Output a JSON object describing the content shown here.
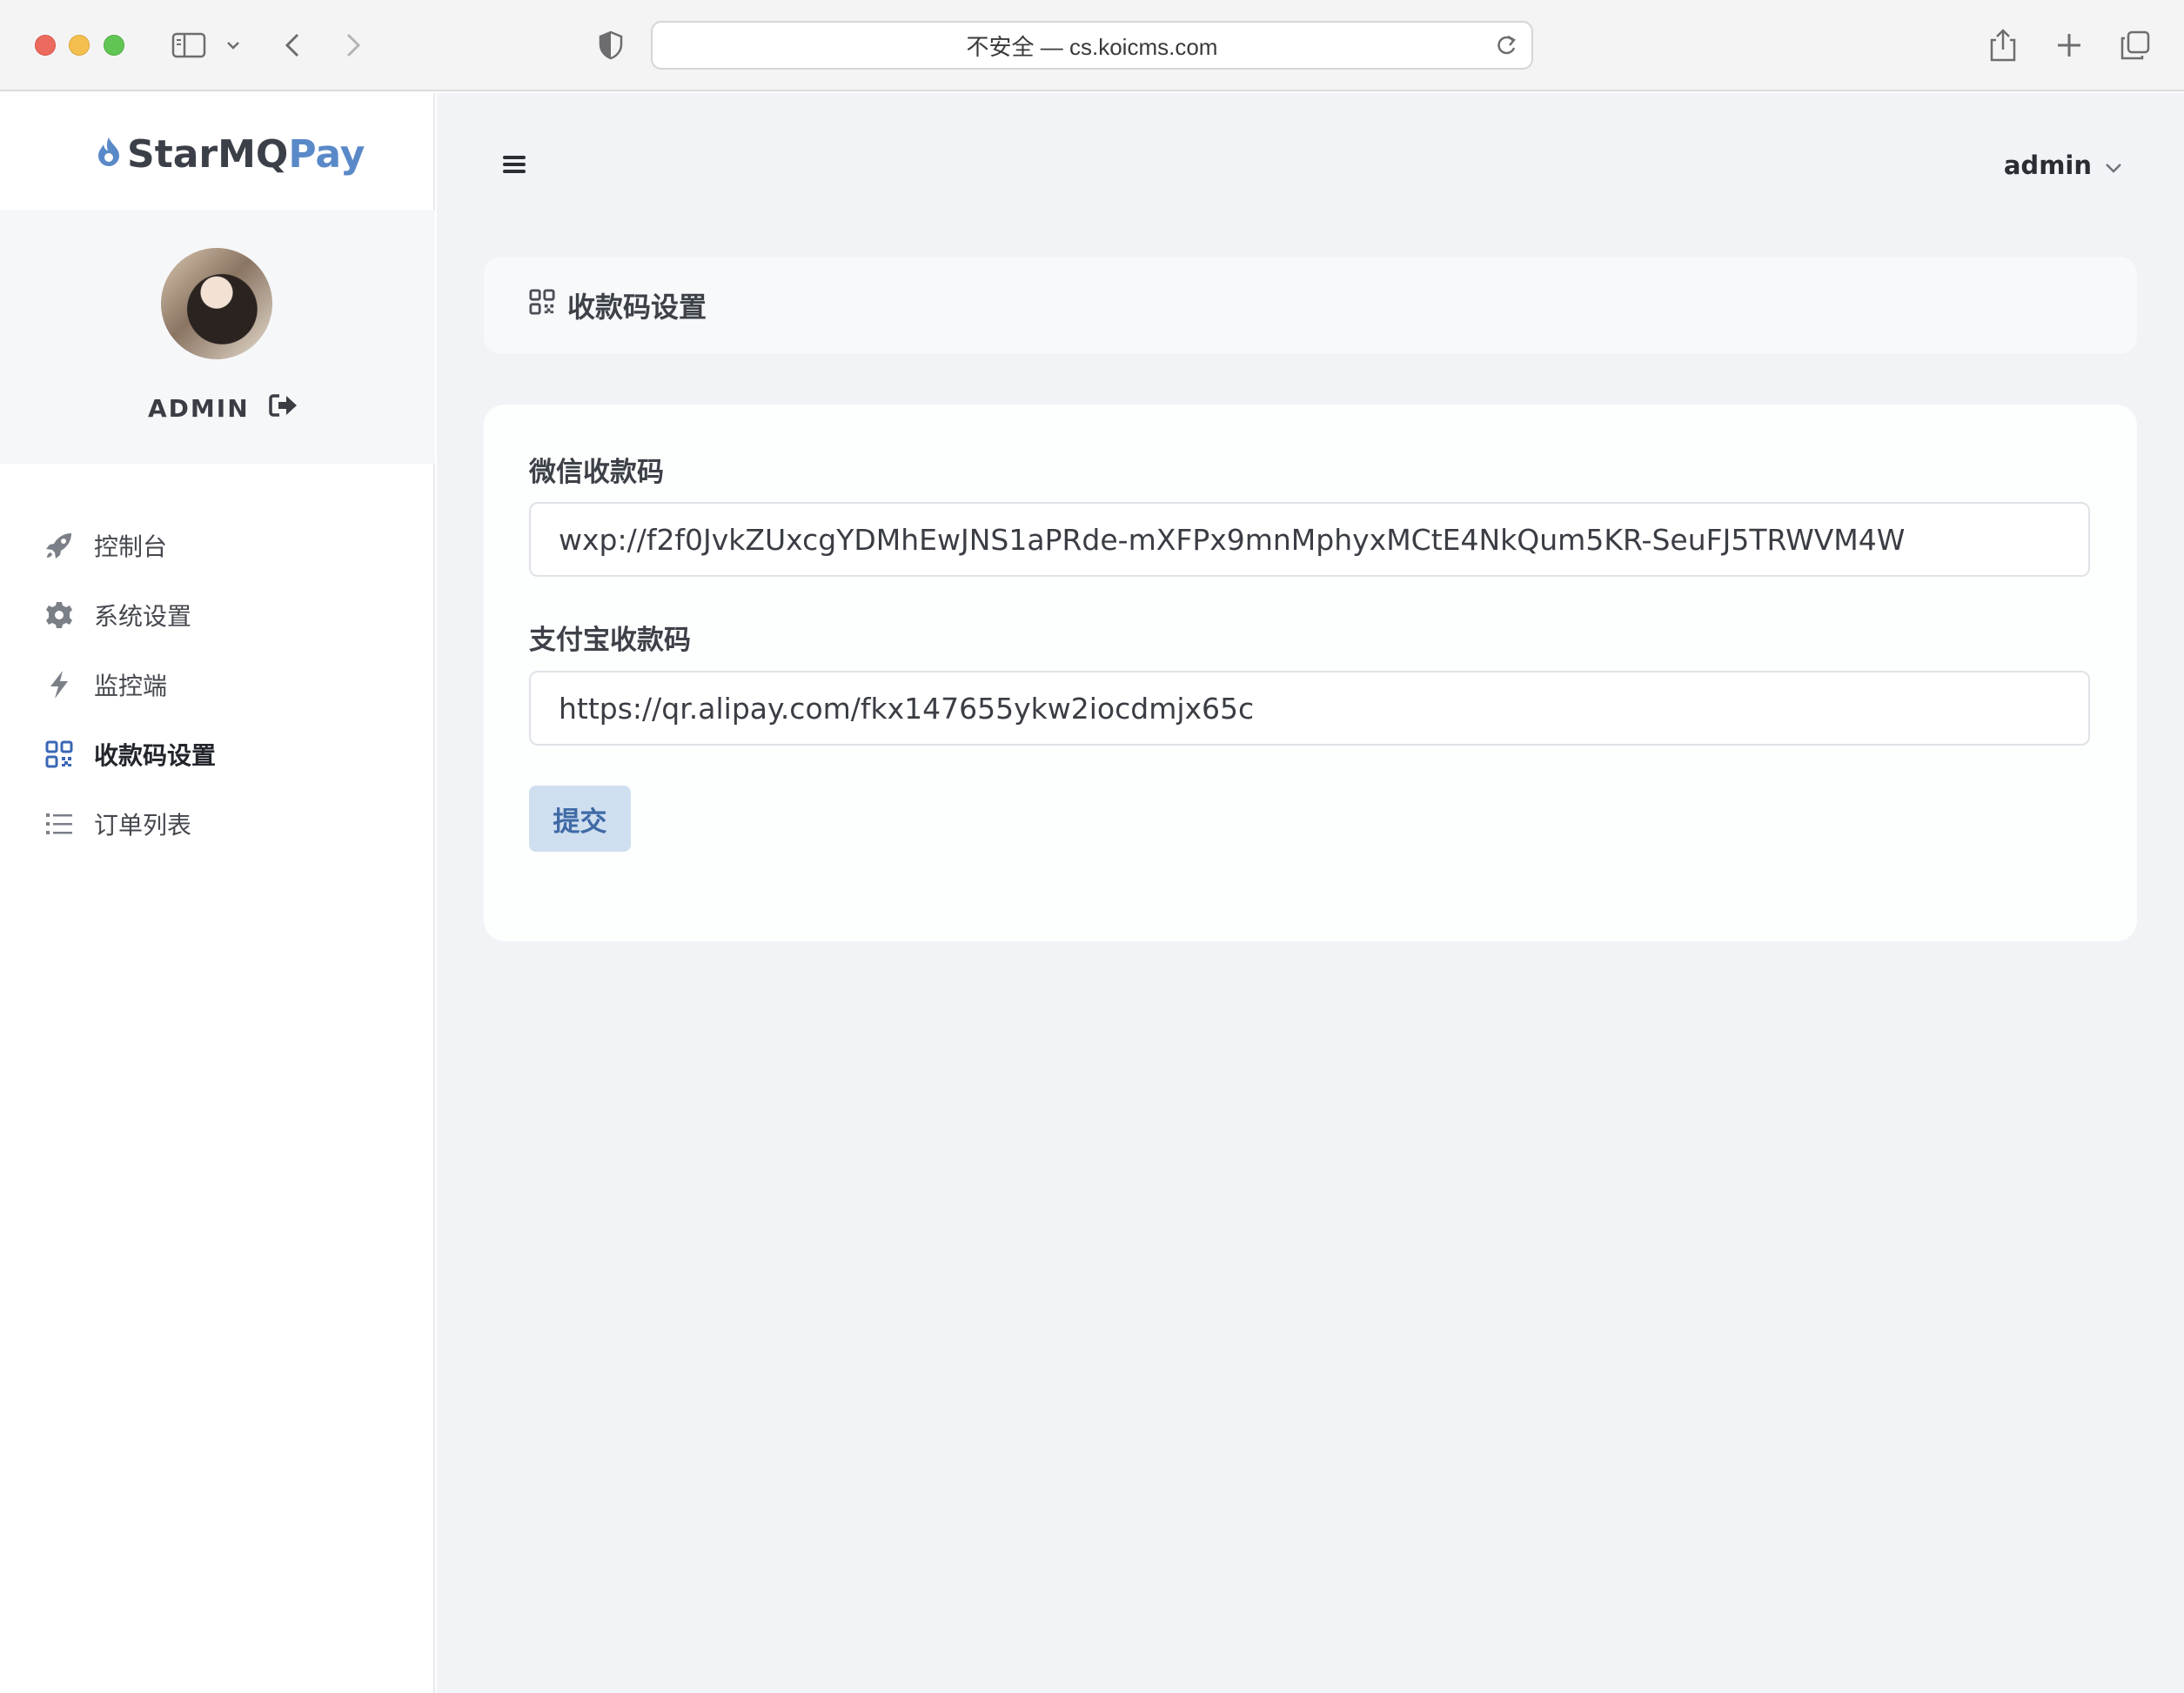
{
  "browser": {
    "url_text": "不安全 — cs.koicms.com"
  },
  "brand": {
    "name_part1": "StarMQ",
    "name_part2": "Pay",
    "accent_color": "#5a89c8"
  },
  "profile": {
    "username": "ADMIN"
  },
  "sidebar": {
    "items": [
      {
        "label": "控制台",
        "icon": "rocket-icon",
        "active": false
      },
      {
        "label": "系统设置",
        "icon": "gear-icon",
        "active": false
      },
      {
        "label": "监控端",
        "icon": "bolt-icon",
        "active": false
      },
      {
        "label": "收款码设置",
        "icon": "qrcode-icon",
        "active": true
      },
      {
        "label": "订单列表",
        "icon": "list-icon",
        "active": false
      }
    ]
  },
  "header": {
    "user_label": "admin"
  },
  "page": {
    "title": "收款码设置"
  },
  "form": {
    "wechat_label": "微信收款码",
    "wechat_value": "wxp://f2f0JvkZUxcgYDMhEwJNS1aPRde-mXFPx9mnMphyxMCtE4NkQum5KR-SeuFJ5TRWVM4W",
    "alipay_label": "支付宝收款码",
    "alipay_value": "https://qr.alipay.com/fkx147655ykw2iocdmjx65c",
    "submit_label": "提交"
  }
}
